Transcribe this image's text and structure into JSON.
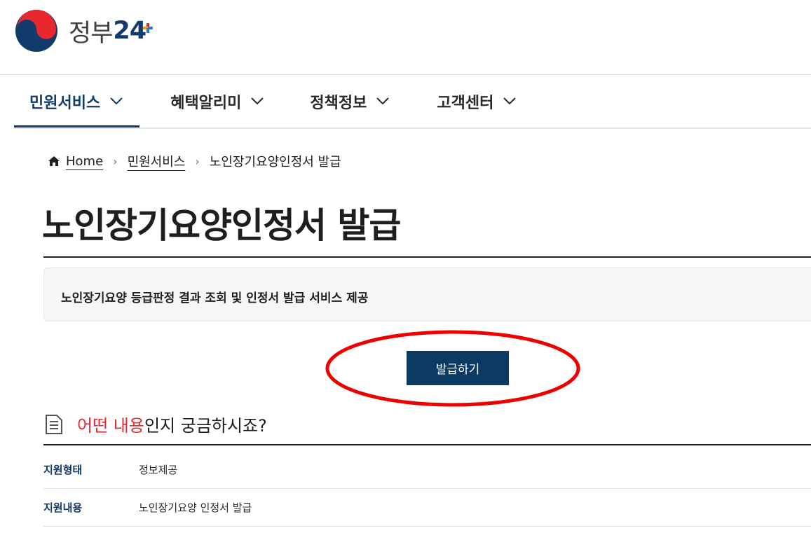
{
  "header": {
    "logo_text": "정부",
    "logo_number": "24",
    "colors": {
      "navy": "#123a6b",
      "red": "#e8272e",
      "blue": "#2f77c7",
      "orange": "#f39a1e"
    }
  },
  "gnb": {
    "items": [
      {
        "label": "민원서비스",
        "active": true
      },
      {
        "label": "혜택알리미",
        "active": false
      },
      {
        "label": "정책정보",
        "active": false
      },
      {
        "label": "고객센터",
        "active": false
      }
    ]
  },
  "breadcrumb": {
    "home": "Home",
    "level1": "민원서비스",
    "current": "노인장기요양인정서 발급"
  },
  "page": {
    "title": "노인장기요양인정서 발급",
    "summary": "노인장기요양 등급판정 결과 조회 및 인정서 발급 서비스 제공",
    "issue_button": "발급하기"
  },
  "section": {
    "title_highlight": "어떤 내용",
    "title_rest": "인지 궁금하시죠?",
    "rows": [
      {
        "label": "지원형태",
        "value": "정보제공"
      },
      {
        "label": "지원내용",
        "value": "노인장기요양 인정서 발급"
      }
    ]
  }
}
